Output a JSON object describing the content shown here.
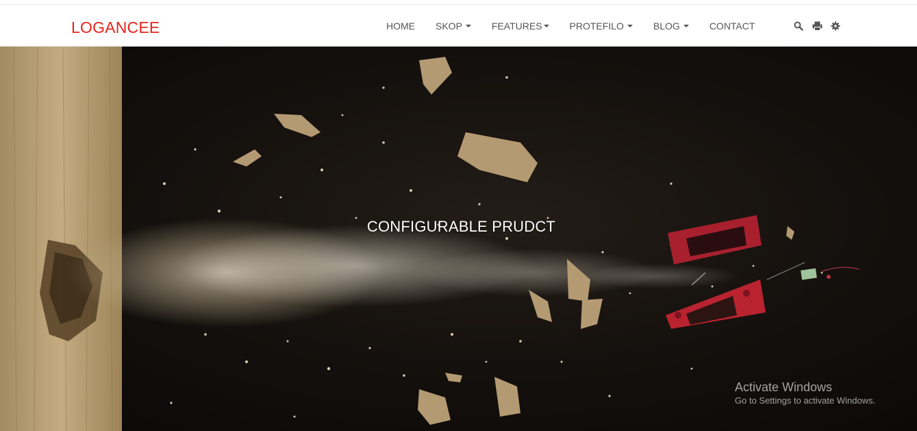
{
  "brand": {
    "name": "LOGANCEE",
    "color": "#e8221c"
  },
  "nav": {
    "items": [
      {
        "label": "HOME",
        "dropdown": false
      },
      {
        "label": "SKOP",
        "dropdown": true
      },
      {
        "label": "FEATURES",
        "dropdown": true
      },
      {
        "label": "PROTEFILO",
        "dropdown": true
      },
      {
        "label": "BLOG",
        "dropdown": true
      },
      {
        "label": "CONTACT",
        "dropdown": false
      }
    ],
    "tools": [
      "search-icon",
      "print-icon",
      "gear-icon"
    ],
    "text_color": "#555555"
  },
  "hero": {
    "title": "CONFIGURABLE PRUDCT",
    "title_color": "#ffffff",
    "background_color": "#130f0c"
  },
  "os_watermark": {
    "title": "Activate Windows",
    "subtitle": "Go to Settings to activate Windows."
  }
}
